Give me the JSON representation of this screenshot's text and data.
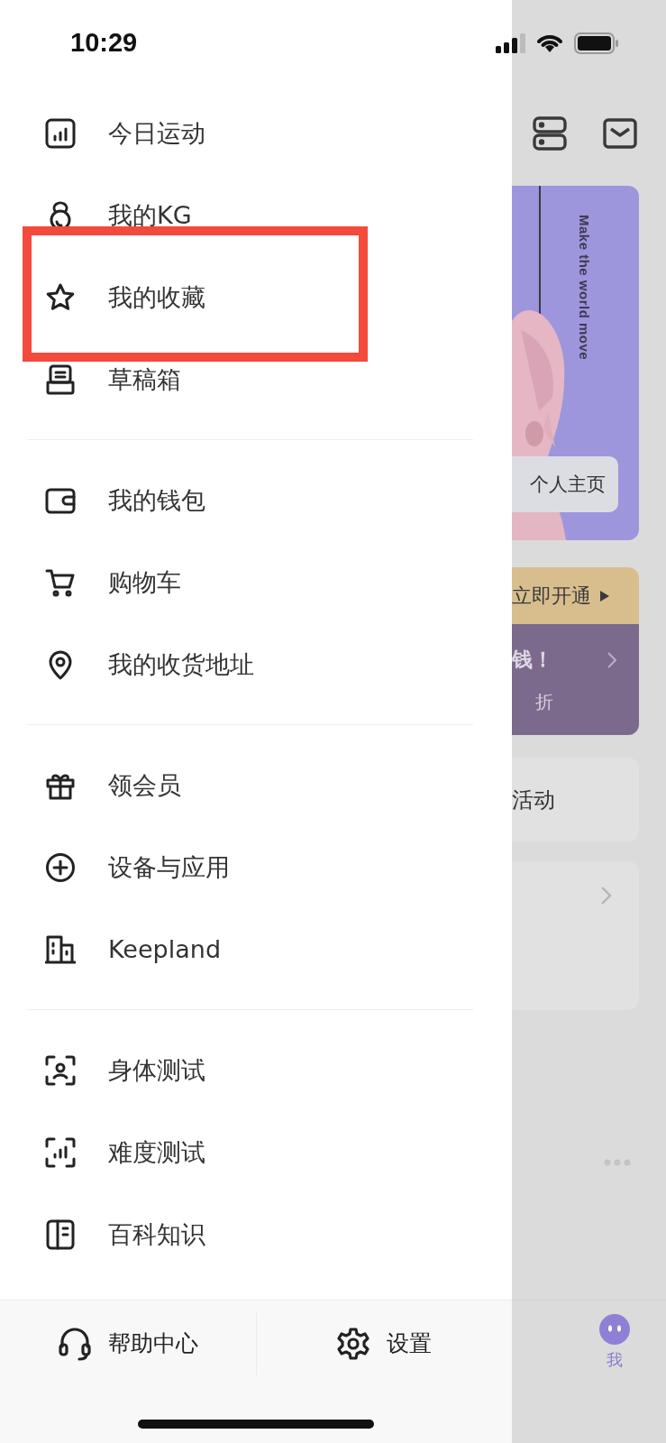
{
  "status_bar": {
    "time": "10:29"
  },
  "menu_groups": [
    [
      {
        "label": "今日运动",
        "kind": "chart",
        "highlighted": false
      },
      {
        "label": "我的KG",
        "kind": "kettlebell",
        "highlighted": false
      },
      {
        "label": "我的收藏",
        "kind": "star",
        "highlighted": true
      },
      {
        "label": "草稿箱",
        "kind": "drafts",
        "highlighted": false
      }
    ],
    [
      {
        "label": "我的钱包",
        "kind": "wallet",
        "highlighted": false
      },
      {
        "label": "购物车",
        "kind": "cart",
        "highlighted": false
      },
      {
        "label": "我的收货地址",
        "kind": "pin",
        "highlighted": false
      }
    ],
    [
      {
        "label": "领会员",
        "kind": "gift",
        "highlighted": false
      },
      {
        "label": "设备与应用",
        "kind": "plus",
        "highlighted": false
      },
      {
        "label": "Keepland",
        "kind": "building",
        "highlighted": false
      }
    ],
    [
      {
        "label": "身体测试",
        "kind": "facescan",
        "highlighted": false
      },
      {
        "label": "难度测试",
        "kind": "barscan",
        "highlighted": false
      },
      {
        "label": "百科知识",
        "kind": "book",
        "highlighted": false
      }
    ]
  ],
  "footer": [
    {
      "label": "帮助中心",
      "kind": "headset"
    },
    {
      "label": "设置",
      "kind": "gear"
    }
  ],
  "background": {
    "banner_text": "Make the world move",
    "profile_button": "个人主页",
    "vip_button": "立即开通",
    "promo_text": "钱！",
    "promo_sub": "折",
    "activity": "活动",
    "tab_label": "我"
  }
}
